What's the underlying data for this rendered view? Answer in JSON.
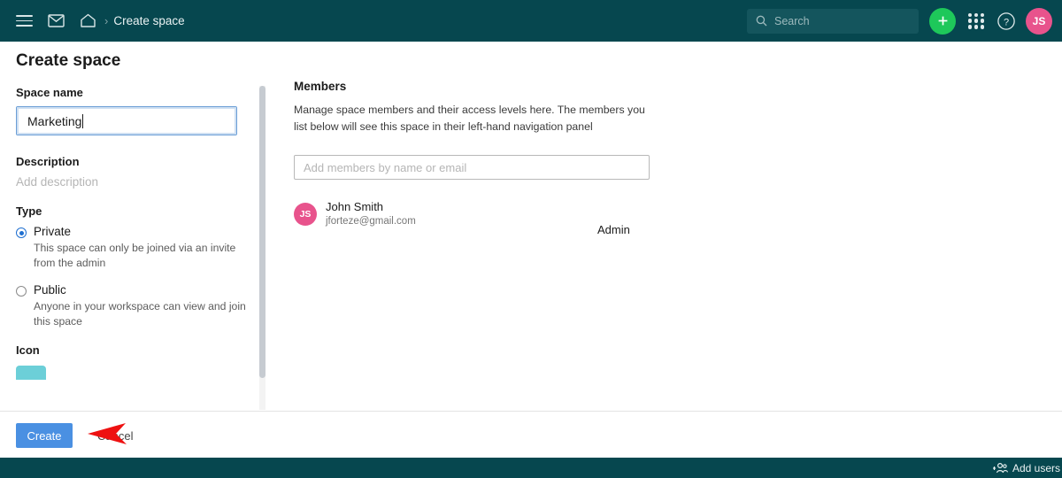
{
  "header": {
    "menu_icon": "hamburger-icon",
    "mail_icon": "envelope-icon",
    "home_icon": "home-icon",
    "breadcrumb_separator": "›",
    "breadcrumb_title": "Create space",
    "search": {
      "icon": "search-icon",
      "placeholder": "Search"
    },
    "create_new_icon": "plus-icon",
    "apps_icon": "grid-apps-icon",
    "help_icon": "question-mark-icon",
    "avatar_initials": "JS",
    "colors": {
      "bar": "#06474f",
      "search_field": "#14555d",
      "plus_button": "#1ec85a",
      "avatar": "#e8538c"
    }
  },
  "page": {
    "title": "Create space"
  },
  "form": {
    "space_name": {
      "label": "Space name",
      "value": "Marketing",
      "focused": true
    },
    "description": {
      "label": "Description",
      "placeholder": "Add description"
    },
    "type": {
      "label": "Type",
      "options": [
        {
          "label": "Private",
          "description": "This space can only be joined via an invite from the admin",
          "selected": true
        },
        {
          "label": "Public",
          "description": "Anyone in your workspace can view and join this space",
          "selected": false
        }
      ]
    },
    "icon": {
      "label": "Icon",
      "swatch_color": "#6ccfd8"
    }
  },
  "members": {
    "heading": "Members",
    "description": "Manage space members and their access levels here. The members you list below will see this space in their left-hand navigation panel",
    "input_placeholder": "Add members by name or email",
    "list": [
      {
        "initials": "JS",
        "name": "John Smith",
        "email": "jforteze@gmail.com",
        "role": "Admin",
        "avatar_color": "#e8538c"
      }
    ]
  },
  "footer": {
    "create_label": "Create",
    "cancel_label": "Cancel",
    "create_color": "#4a90e2",
    "annotation": {
      "shape": "left-pointing-arrow",
      "color": "#ee1111"
    }
  },
  "bottom_bar": {
    "add_users_icon": "add-user-icon",
    "add_users_label": "Add users"
  }
}
